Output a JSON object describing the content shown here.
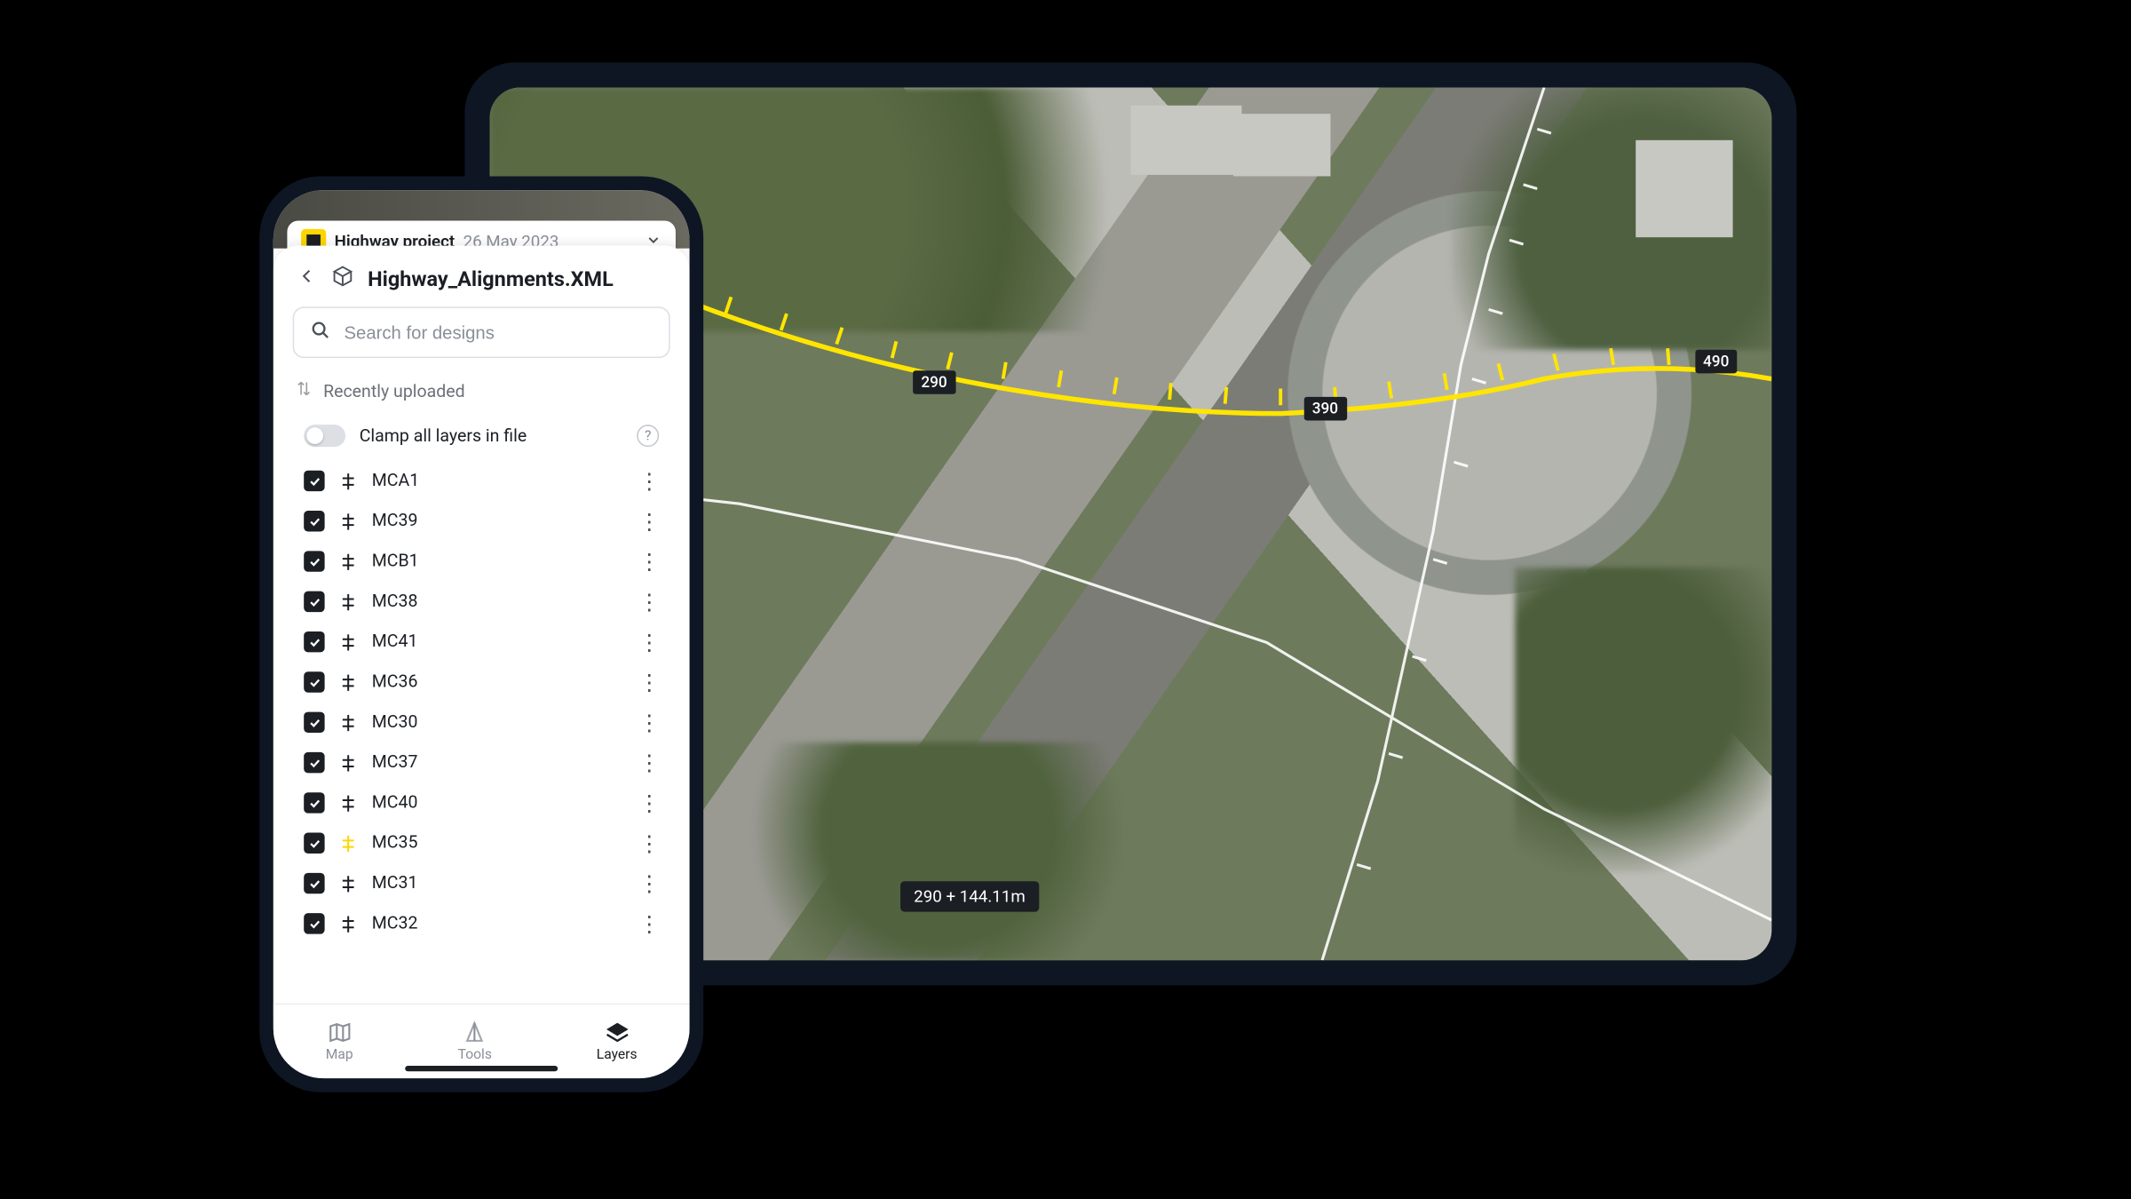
{
  "project": {
    "name": "Highway project",
    "date": "26 May 2023"
  },
  "sheet": {
    "title": "Highway_Alignments.XML",
    "search_placeholder": "Search for designs",
    "recent_label": "Recently uploaded",
    "clamp_label": "Clamp all layers in file"
  },
  "layers": [
    {
      "name": "MCA1",
      "checked": true,
      "highlight": false
    },
    {
      "name": "MC39",
      "checked": true,
      "highlight": false
    },
    {
      "name": "MCB1",
      "checked": true,
      "highlight": false
    },
    {
      "name": "MC38",
      "checked": true,
      "highlight": false
    },
    {
      "name": "MC41",
      "checked": true,
      "highlight": false
    },
    {
      "name": "MC36",
      "checked": true,
      "highlight": false
    },
    {
      "name": "MC30",
      "checked": true,
      "highlight": false
    },
    {
      "name": "MC37",
      "checked": true,
      "highlight": false
    },
    {
      "name": "MC40",
      "checked": true,
      "highlight": false
    },
    {
      "name": "MC35",
      "checked": true,
      "highlight": true
    },
    {
      "name": "MC31",
      "checked": true,
      "highlight": false
    },
    {
      "name": "MC32",
      "checked": true,
      "highlight": false
    }
  ],
  "tabs": {
    "map": "Map",
    "tools": "Tools",
    "layers": "Layers",
    "active": "layers"
  },
  "map": {
    "chainages": {
      "a": "290",
      "b": "390",
      "c": "490"
    },
    "measurement": "290 + 144.11m"
  },
  "colors": {
    "alignment": "#ffe500",
    "overlay_white": "#ffffff",
    "dark": "#1b1f24"
  }
}
